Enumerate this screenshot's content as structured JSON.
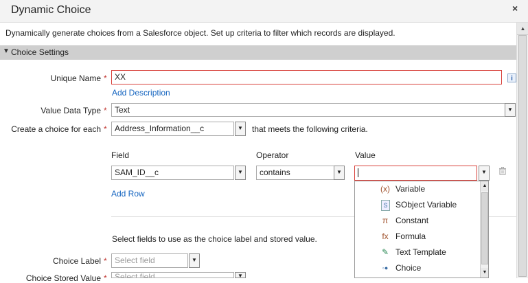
{
  "dialog": {
    "title": "Dynamic Choice",
    "close_label": "×",
    "description": "Dynamically generate choices from a Salesforce object. Set up criteria to filter which records are displayed."
  },
  "section": {
    "title": "Choice Settings"
  },
  "form": {
    "required_mark": "*",
    "unique_name": {
      "label": "Unique Name",
      "value": "XX"
    },
    "add_description": "Add Description",
    "value_data_type": {
      "label": "Value Data Type",
      "value": "Text"
    },
    "create_choice": {
      "label": "Create a choice for each",
      "value": "Address_Information__c",
      "suffix": "that meets the following criteria."
    },
    "criteria": {
      "field_header": "Field",
      "operator_header": "Operator",
      "value_header": "Value",
      "field_value": "SAM_ID__c",
      "operator_value": "contains",
      "value_value": ""
    },
    "add_row": "Add Row",
    "select_fields_text": "Select fields to use as the choice label and stored value.",
    "choice_label": {
      "label": "Choice Label",
      "placeholder": "Select field"
    },
    "choice_stored_value": {
      "label": "Choice Stored Value",
      "placeholder": "Select field"
    }
  },
  "value_dropdown": {
    "items": [
      {
        "label": "Variable",
        "icon": "variable-icon",
        "glyph": "(x)",
        "color": "#a0522d"
      },
      {
        "label": "SObject Variable",
        "icon": "sobject-variable-icon",
        "glyph": "S",
        "color": "#3b6ea5"
      },
      {
        "label": "Constant",
        "icon": "constant-icon",
        "glyph": "π",
        "color": "#a0522d"
      },
      {
        "label": "Formula",
        "icon": "formula-icon",
        "glyph": "fx",
        "color": "#a0522d"
      },
      {
        "label": "Text Template",
        "icon": "text-template-icon",
        "glyph": "✎",
        "color": "#2e8b57"
      },
      {
        "label": "Choice",
        "icon": "choice-icon",
        "glyph": "◦●",
        "color": "#3b6ea5"
      }
    ]
  },
  "colors": {
    "error_border": "#d8403a",
    "link": "#1565c0",
    "section_bg": "#cfcfcf",
    "required": "#c23934"
  }
}
